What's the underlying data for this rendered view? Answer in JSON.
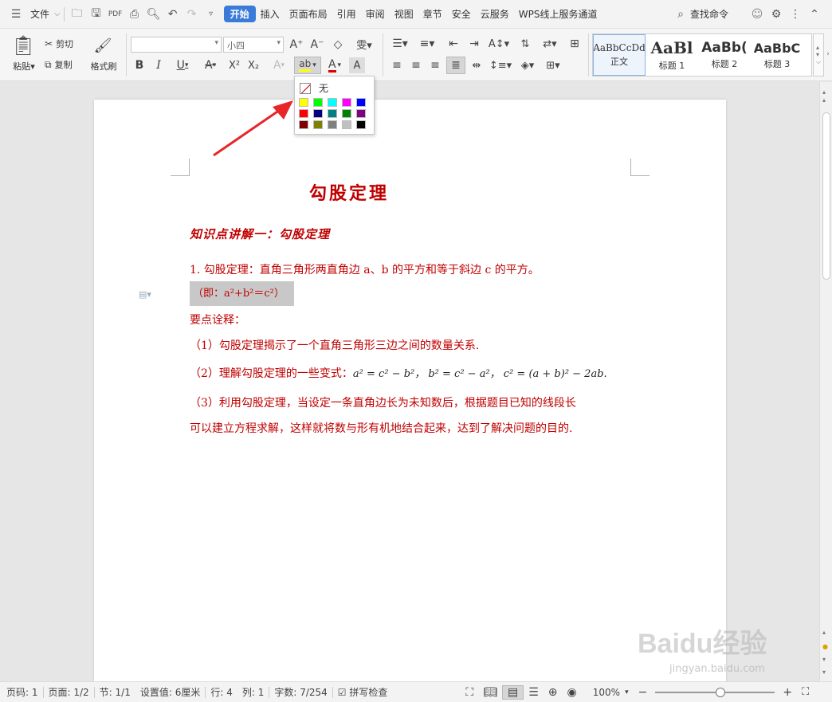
{
  "menu": {
    "file": "文件",
    "tabs": [
      "开始",
      "插入",
      "页面布局",
      "引用",
      "审阅",
      "视图",
      "章节",
      "安全",
      "云服务",
      "WPS线上服务通道"
    ],
    "search": "查找命令"
  },
  "ribbon": {
    "paste": "粘贴",
    "cut": "剪切",
    "copy": "复制",
    "format_painter": "格式刷",
    "font_name": "",
    "font_size": "小四",
    "styles": [
      {
        "sample": "AaBbCcDd",
        "name": "正文"
      },
      {
        "sample": "AaBl",
        "name": "标题 1"
      },
      {
        "sample": "AaBb(",
        "name": "标题 2"
      },
      {
        "sample": "AaBbC",
        "name": "标题 3"
      }
    ]
  },
  "highlight_popup": {
    "none_label": "无",
    "colors": [
      "#ffff00",
      "#00ff00",
      "#00ffff",
      "#ff00ff",
      "#0000ff",
      "#ff0000",
      "#000080",
      "#008080",
      "#008000",
      "#800080",
      "#800000",
      "#808000",
      "#808080",
      "#c0c0c0",
      "#000000"
    ]
  },
  "document": {
    "title": "勾股定理",
    "subtitle": "知识点讲解一：勾股定理",
    "p1": "1. 勾股定理：直角三角形两直角边 a、b 的平方和等于斜边 c 的平方。",
    "p2": "（即：a²+b²＝c²）",
    "p3": "要点诠释：",
    "p4": "（1）勾股定理揭示了一个直角三角形三边之间的数量关系.",
    "p5": "（2）理解勾股定理的一些变式：",
    "p5_math": "a² = c² − b²，  b² = c² − a²，   c² = (a + b)² − 2ab.",
    "p6": "（3）利用勾股定理，当设定一条直角边长为未知数后，根据题目已知的线段长",
    "p7": "可以建立方程求解，这样就将数与形有机地结合起来，达到了解决问题的目的."
  },
  "status": {
    "page_code": "页码: 1",
    "page": "页面: 1/2",
    "section": "节: 1/1",
    "setting": "设置值: 6厘米",
    "row": "行: 4",
    "col": "列: 1",
    "words": "字数: 7/254",
    "spellcheck": "拼写检查",
    "zoom": "100%"
  },
  "watermark": {
    "logo": "Baidu经验",
    "url": "jingyan.baidu.com"
  },
  "icons": [
    "menu-icon",
    "open-icon",
    "save-icon",
    "pdf-icon",
    "print-icon",
    "preview-icon",
    "undo-icon",
    "redo-icon",
    "search-icon",
    "settings-icon",
    "more-icon",
    "close-icon"
  ]
}
